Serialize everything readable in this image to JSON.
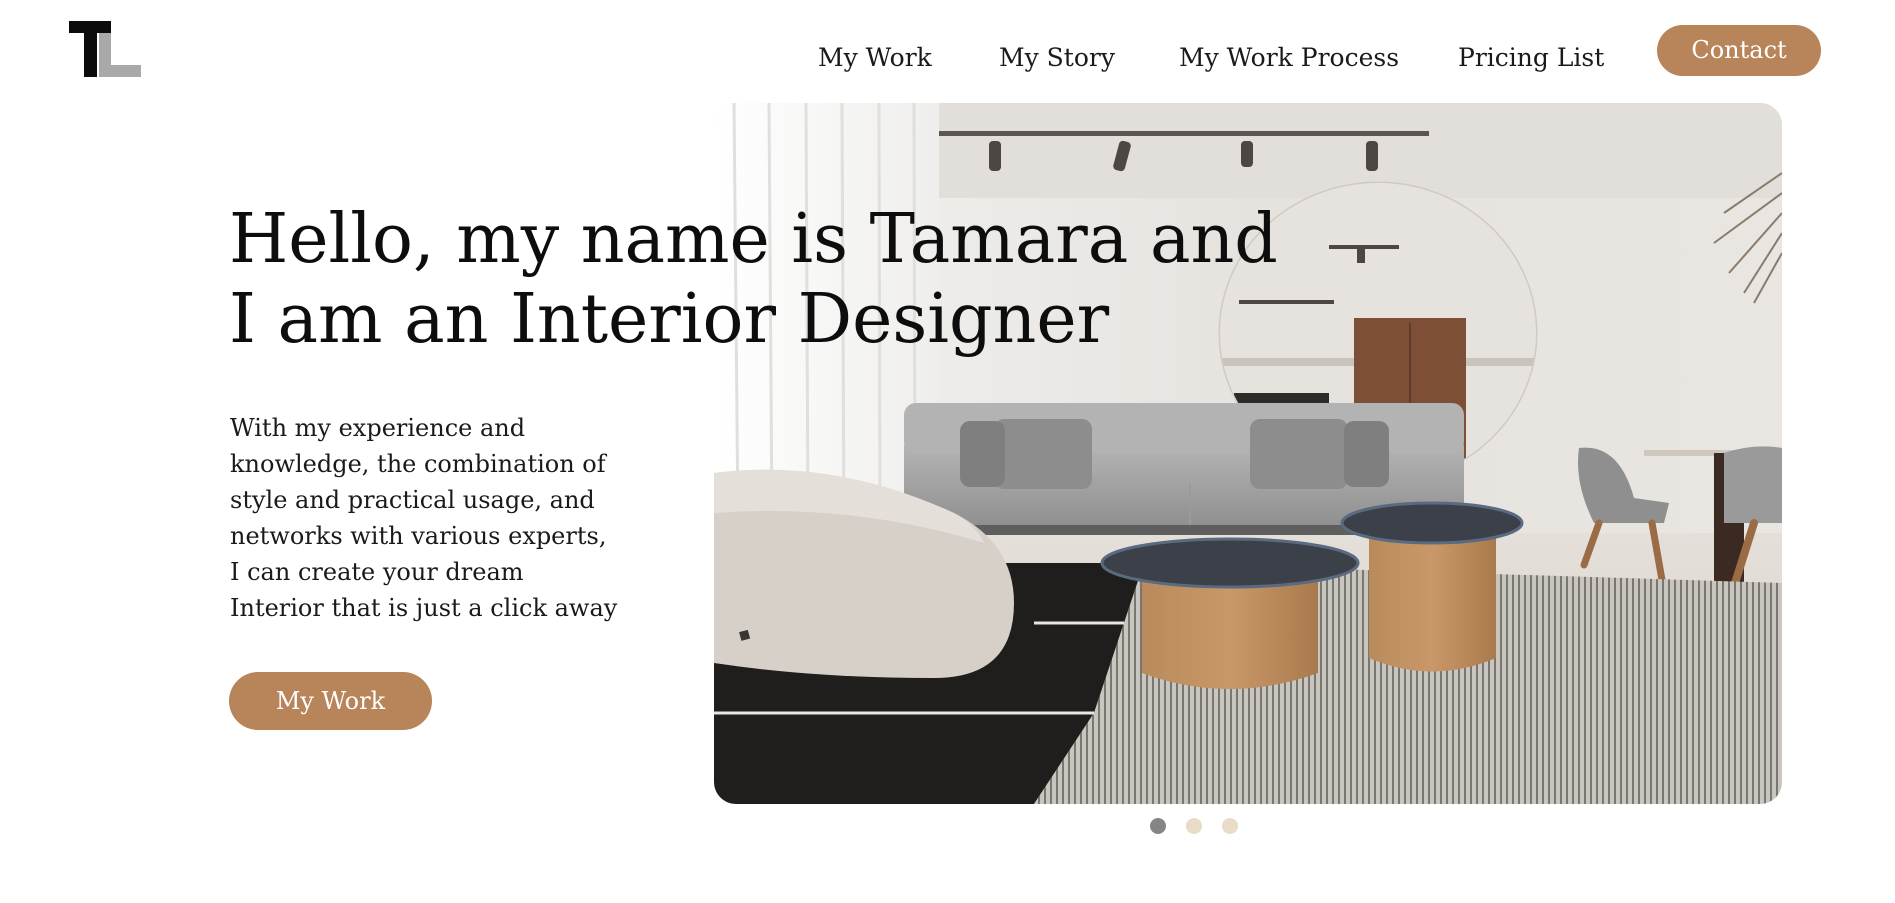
{
  "brand": {
    "logo_icon": "tl-monogram-logo",
    "accent_color": "#b8845a"
  },
  "nav": {
    "items": [
      {
        "label": "My Work"
      },
      {
        "label": "My Story"
      },
      {
        "label": "My Work Process"
      },
      {
        "label": "Pricing List"
      }
    ],
    "contact_label": "Contact"
  },
  "hero": {
    "title_lines": [
      "Hello, my name is Tamara and",
      "I am an Interior Designer"
    ],
    "description_lines": [
      "With my experience and",
      "knowledge, the combination of",
      "style and practical usage, and",
      "networks with various experts,",
      "I can create your dream",
      "Interior that is just a click away"
    ],
    "cta_label": "My Work",
    "image": "living-room-interior-photo"
  },
  "carousel": {
    "slide_count": 3,
    "active_index": 0,
    "active_color": "#858585",
    "inactive_color": "#e8dcc6"
  }
}
